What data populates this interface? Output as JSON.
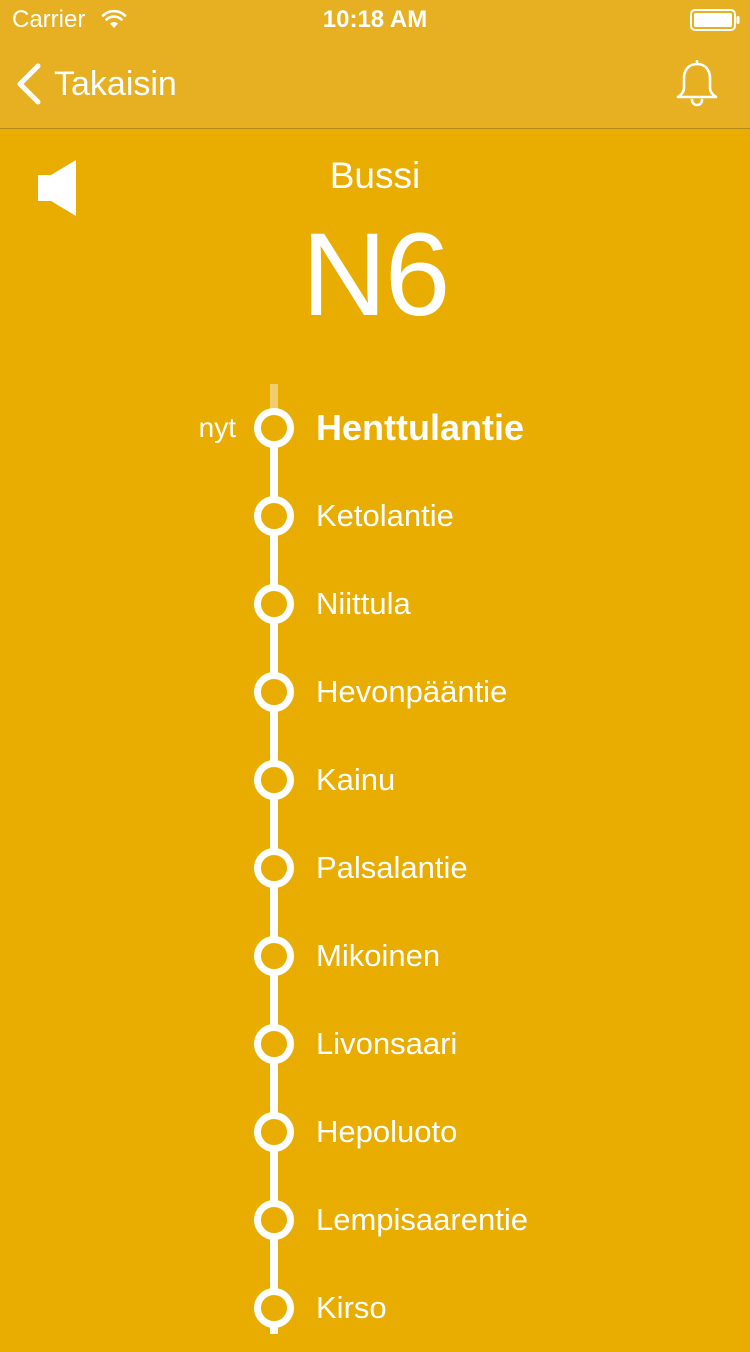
{
  "status_bar": {
    "carrier": "Carrier",
    "time": "10:18 AM"
  },
  "nav": {
    "back_label": "Takaisin"
  },
  "header": {
    "vehicle_type": "Bussi",
    "route_number": "N6"
  },
  "route": {
    "now_label": "nyt",
    "stops": [
      {
        "name": "Henttulantie",
        "current": true
      },
      {
        "name": "Ketolantie",
        "current": false
      },
      {
        "name": "Niittula",
        "current": false
      },
      {
        "name": "Hevonpääntie",
        "current": false
      },
      {
        "name": "Kainu",
        "current": false
      },
      {
        "name": "Palsalantie",
        "current": false
      },
      {
        "name": "Mikoinen",
        "current": false
      },
      {
        "name": "Livonsaari",
        "current": false
      },
      {
        "name": "Hepoluoto",
        "current": false
      },
      {
        "name": "Lempisaarentie",
        "current": false
      },
      {
        "name": "Kirso",
        "current": false
      }
    ]
  },
  "colors": {
    "background": "#E9AC00",
    "bar": "#E6B022",
    "foreground": "#FFFFFF",
    "passed_line": "#F2CD6E"
  },
  "icons": {
    "back": "chevron-left-icon",
    "bell": "bell-icon",
    "speaker": "speaker-icon",
    "wifi": "wifi-icon",
    "battery": "battery-icon"
  }
}
